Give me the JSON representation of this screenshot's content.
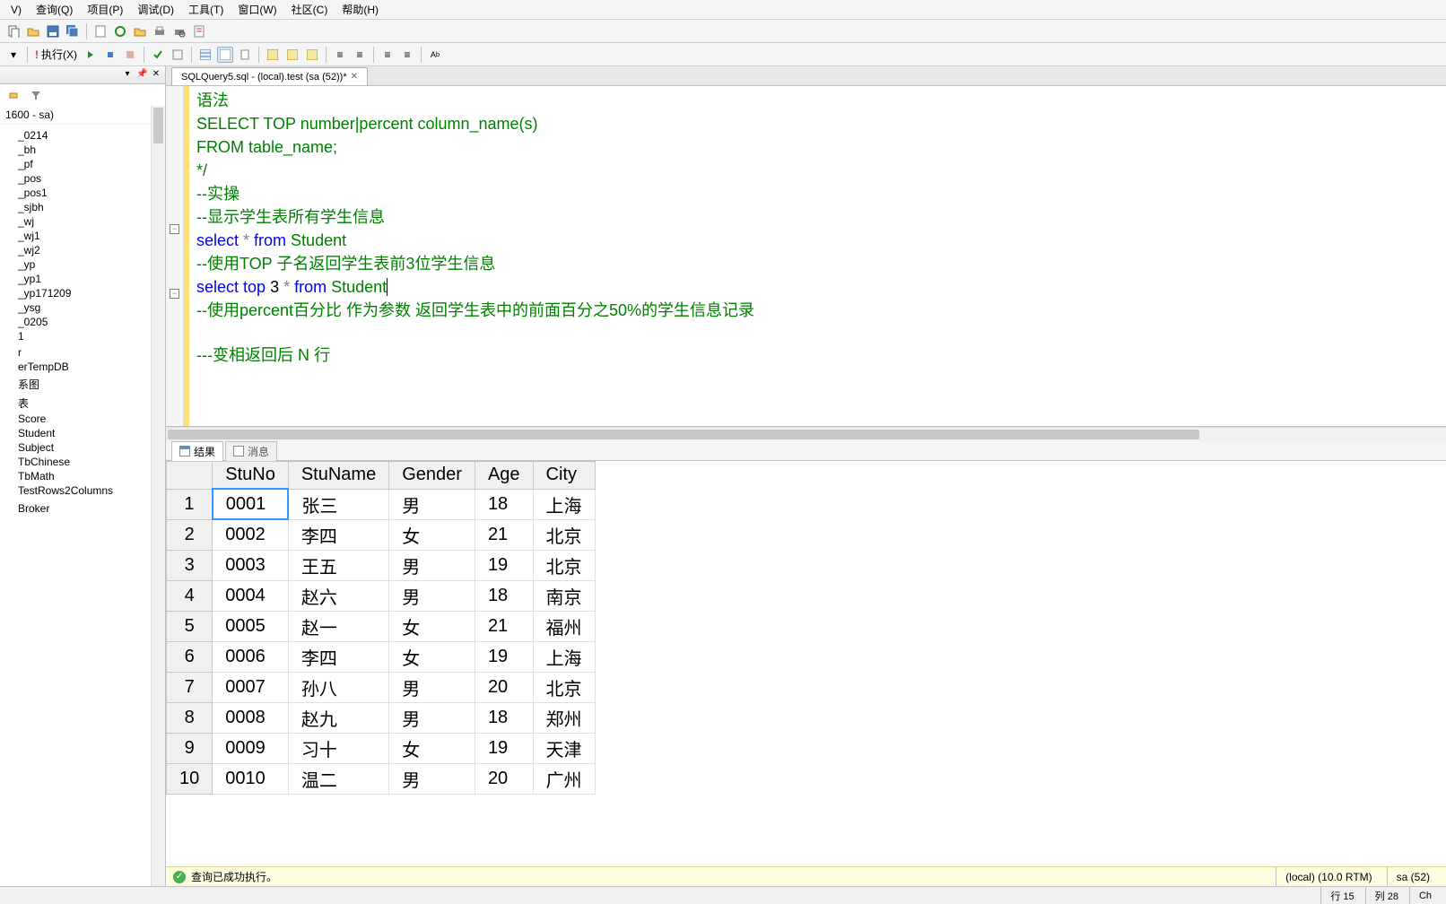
{
  "menu": {
    "items": [
      "V)",
      "查询(Q)",
      "项目(P)",
      "调试(D)",
      "工具(T)",
      "窗口(W)",
      "社区(C)",
      "帮助(H)"
    ]
  },
  "toolbar1": {
    "icons": [
      "new-query",
      "open",
      "save",
      "save-all",
      "sep",
      "page",
      "refresh",
      "print",
      "print-preview",
      "grid",
      "sep",
      "script"
    ]
  },
  "toolbar2": {
    "exec_label": "执行(X)",
    "icons_pre": [
      "db-dropdown",
      "sep",
      "red-bang"
    ],
    "icons_post": [
      "play",
      "debug",
      "stop",
      "sep",
      "check",
      "outline",
      "sep",
      "grid1",
      "grid2",
      "sep",
      "plan1",
      "plan2",
      "plan3",
      "sep",
      "indent-l",
      "indent-r",
      "sep",
      "comment",
      "uncomment",
      "sep",
      "case"
    ]
  },
  "connection_label": "1600 - sa)",
  "tree_items": [
    "_0214",
    "_bh",
    "_pf",
    "_pos",
    "_pos1",
    "_sjbh",
    "_wj",
    "_wj1",
    "_wj2",
    "_yp",
    "_yp1",
    "_yp171209",
    "_ysg",
    "_0205",
    "1",
    "",
    "r",
    "erTempDB",
    "",
    "系图",
    "",
    "表",
    "Score",
    "Student",
    "Subject",
    "TbChinese",
    "TbMath",
    "TestRows2Columns",
    "",
    "",
    "Broker"
  ],
  "tab": {
    "title": "SQLQuery5.sql - (local).test (sa (52))*"
  },
  "code": {
    "l1": "语法",
    "l2": "SELECT TOP number|percent column_name(s)",
    "l3": "FROM table_name;",
    "l4": "*/",
    "l5": "--实操",
    "l6": "--显示学生表所有学生信息",
    "l7a": "select",
    "l7b": " * ",
    "l7c": "from",
    "l7d": " Student",
    "l8": "--使用TOP 子名返回学生表前3位学生信息",
    "l9a": "select",
    "l9b": " top ",
    "l9c": "3",
    "l9d": " * ",
    "l9e": "from",
    "l9f": " Student",
    "l10a": "--使用percent百分比 作为参数 返回学生表中的前面百分之",
    "l10b": "50%",
    "l10c": "的学生信息记录",
    "l11": "---变相返回后 N 行"
  },
  "results_tabs": {
    "results": "结果",
    "messages": "消息"
  },
  "grid": {
    "headers": [
      "StuNo",
      "StuName",
      "Gender",
      "Age",
      "City"
    ],
    "rows": [
      [
        "0001",
        "张三",
        "男",
        "18",
        "上海"
      ],
      [
        "0002",
        "李四",
        "女",
        "21",
        "北京"
      ],
      [
        "0003",
        "王五",
        "男",
        "19",
        "北京"
      ],
      [
        "0004",
        "赵六",
        "男",
        "18",
        "南京"
      ],
      [
        "0005",
        "赵一",
        "女",
        "21",
        "福州"
      ],
      [
        "0006",
        "李四",
        "女",
        "19",
        "上海"
      ],
      [
        "0007",
        "孙八",
        "男",
        "20",
        "北京"
      ],
      [
        "0008",
        "赵九",
        "男",
        "18",
        "郑州"
      ],
      [
        "0009",
        "习十",
        "女",
        "19",
        "天津"
      ],
      [
        "0010",
        "温二",
        "男",
        "20",
        "广州"
      ]
    ]
  },
  "status": {
    "ok": "查询已成功执行。",
    "server": "(local) (10.0 RTM)",
    "user": "sa (52)",
    "row": "行 15",
    "col": "列 28",
    "ch": "Ch"
  }
}
